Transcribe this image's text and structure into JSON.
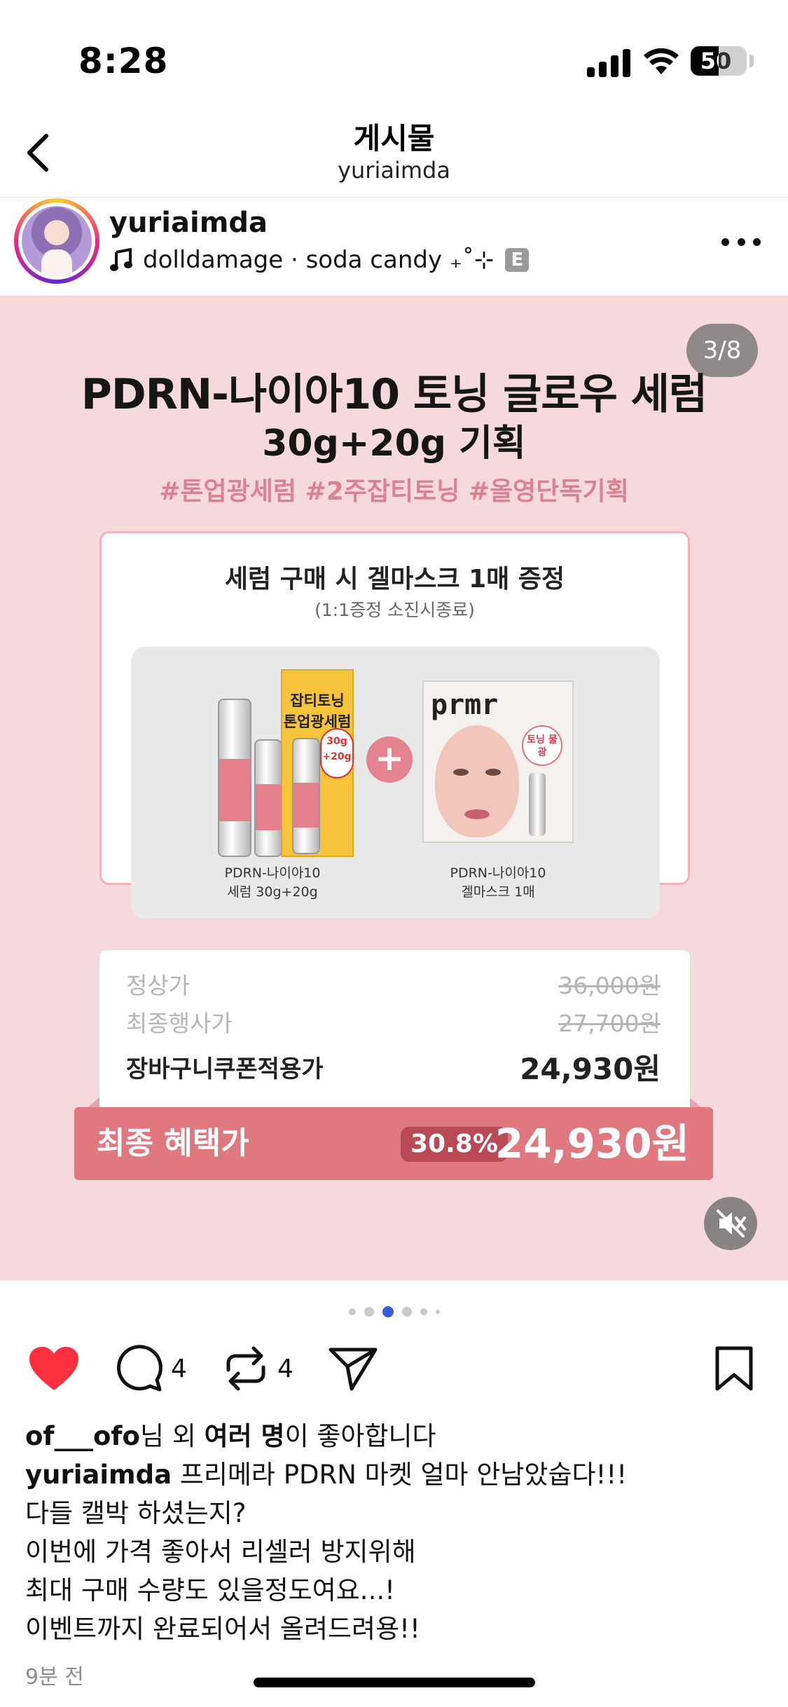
{
  "status_bar": {
    "time": "8:28",
    "battery": "50",
    "battery_level": 0.5
  },
  "header": {
    "title": "게시물",
    "subtitle": "yuriaimda"
  },
  "post": {
    "username": "yuriaimda",
    "music": "dolldamage · soda candy ₊˚⊹",
    "badge": "E"
  },
  "image": {
    "page_counter": "3/8",
    "title": "PDRN-나이아10 토닝 글로우 세럼",
    "subtitle": "30g+20g 기획",
    "hashtags": "#톤업광세럼 #2주잡티토닝 #올영단독기획",
    "gift": {
      "title": "세럼 구매 시 겔마스크 1매 증정",
      "note": "(1:1증정 소진시종료)",
      "box_text_1": "잡티토닝",
      "box_text_2": "톤업광세럼",
      "box_badge": "30g +20g",
      "mask_logo": "prmr",
      "mask_badge": "토닝 물광",
      "product1_label_1": "PDRN-나이아10",
      "product1_label_2": "세럼 30g+20g",
      "product2_label_1": "PDRN-나이아10",
      "product2_label_2": "겔마스크 1매"
    },
    "prices": [
      {
        "label": "정상가",
        "value": "36,000원"
      },
      {
        "label": "최종행사가",
        "value": "27,700원"
      },
      {
        "label": "장바구니쿠폰적용가",
        "value": "24,930원"
      }
    ],
    "final": {
      "label": "최종 혜택가",
      "discount": "30.8%",
      "price": "24,930원"
    }
  },
  "carousel": {
    "total": 6,
    "active_index": 2
  },
  "actions": {
    "comments": "4",
    "reposts": "4"
  },
  "likes": {
    "user": "of___ofo",
    "mid": "님 외 ",
    "bold": "여러 명",
    "end": "이 좋아합니다"
  },
  "caption": {
    "user": "yuriaimda",
    "lines": [
      " 프리메라 PDRN 마켓 얼마 안남았숩다!!!",
      "다들 캘박 하셨는지?",
      "이번에 가격 좋아서 리셀러 방지위해",
      "최대 구매 수량도 있을정도여요...!",
      "이벤트까지 완료되어서 올려드려용!!"
    ]
  },
  "time_ago": "9분 전",
  "colors": {
    "panel_bg": "#f6d9dc",
    "accent": "#e0787f",
    "like_red": "#ff3040",
    "active_dot": "#3b5bdb"
  }
}
